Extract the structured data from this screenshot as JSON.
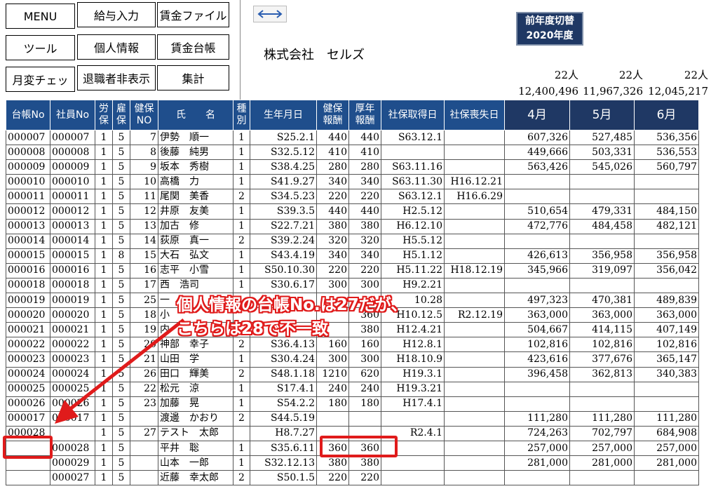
{
  "buttons": {
    "menu": "MENU",
    "kyuyo": "給与入力",
    "chingin_file": "賃金ファイル",
    "tool": "ツール",
    "kojin": "個人情報",
    "chingin_daicho": "賃金台帳",
    "getsuhen": "月変チェッ",
    "taishoku": "退職者非表示",
    "shukei": "集計"
  },
  "arrow_button_icon": "left-right-arrow-icon",
  "company": "株式会社　セルズ",
  "fiscal_button": {
    "line1": "前年度切替",
    "line2": "2020年度"
  },
  "summary": {
    "headcount": [
      "22人",
      "22人",
      "22人"
    ],
    "totals": [
      "12,400,496",
      "11,967,326",
      "12,045,217"
    ]
  },
  "headers": {
    "daicho_no": "台帳No",
    "shain_no": "社員No",
    "rouho": [
      "労",
      "保"
    ],
    "koho": [
      "雇",
      "保"
    ],
    "kenpo_no": [
      "健保",
      "NO"
    ],
    "name": "氏　　名",
    "shubetsu": [
      "種",
      "別"
    ],
    "birth": "生年月日",
    "kenpo_hoshu": [
      "健保",
      "報酬"
    ],
    "kounen_hoshu": [
      "厚年",
      "報酬"
    ],
    "shuto": "社保取得日",
    "soshitsu": "社保喪失日",
    "months": [
      "4月",
      "5月",
      "6月"
    ]
  },
  "rows": [
    [
      "000007",
      "000007",
      "1",
      "5",
      "7",
      "伊勢　順一",
      "1",
      "S25.2.1",
      "440",
      "440",
      "S63.12.1",
      "",
      "607,326",
      "527,485",
      "536,356"
    ],
    [
      "000008",
      "000008",
      "1",
      "5",
      "8",
      "後藤　純男",
      "1",
      "S32.5.12",
      "410",
      "410",
      "",
      "",
      "449,666",
      "503,331",
      "536,553"
    ],
    [
      "000009",
      "000009",
      "1",
      "5",
      "9",
      "坂本　秀樹",
      "1",
      "S38.4.25",
      "280",
      "280",
      "S63.11.16",
      "",
      "563,426",
      "545,026",
      "560,797"
    ],
    [
      "000010",
      "000010",
      "1",
      "5",
      "10",
      "高橋　力",
      "1",
      "S41.9.27",
      "340",
      "340",
      "S63.11.30",
      "H16.12.21",
      "",
      "",
      ""
    ],
    [
      "000011",
      "000011",
      "1",
      "5",
      "11",
      "尾関　美香",
      "2",
      "S34.5.23",
      "220",
      "220",
      "S63.12.1",
      "H16.6.29",
      "",
      "",
      ""
    ],
    [
      "000012",
      "000012",
      "1",
      "5",
      "12",
      "井原　友美",
      "1",
      "S39.3.5",
      "440",
      "440",
      "H2.5.12",
      "",
      "510,654",
      "479,331",
      "484,150"
    ],
    [
      "000013",
      "000013",
      "1",
      "5",
      "13",
      "加古　修",
      "1",
      "S22.7.21",
      "380",
      "380",
      "H6.12.10",
      "",
      "472,776",
      "484,458",
      "482,121"
    ],
    [
      "000014",
      "000014",
      "1",
      "5",
      "14",
      "荻原　真一",
      "2",
      "S39.2.24",
      "320",
      "320",
      "H5.5.12",
      "",
      "",
      "",
      ""
    ],
    [
      "000015",
      "000015",
      "1",
      "8",
      "15",
      "大石　弘文",
      "1",
      "S43.4.19",
      "340",
      "340",
      "H5.1.12",
      "",
      "426,613",
      "356,958",
      "356,958"
    ],
    [
      "000016",
      "000016",
      "1",
      "5",
      "16",
      "志平　小雪",
      "1",
      "S50.10.30",
      "220",
      "220",
      "H5.11.22",
      "H18.12.19",
      "345,966",
      "319,097",
      "356,042"
    ],
    [
      "000018",
      "000018",
      "1",
      "5",
      "17",
      "西　浩司",
      "1",
      "S30.6.17",
      "300",
      "300",
      "H9.2.21",
      "",
      "",
      "",
      ""
    ],
    [
      "000019",
      "000019",
      "1",
      "5",
      "25",
      "一　",
      "",
      "",
      "",
      "",
      "10.28",
      "",
      "497,323",
      "470,381",
      "489,839"
    ],
    [
      "000020",
      "000020",
      "1",
      "5",
      "18",
      "小",
      "",
      "",
      "",
      "360",
      "H10.12.5",
      "R2.12.19",
      "363,000",
      "363,000",
      "363,000"
    ],
    [
      "000021",
      "000021",
      "1",
      "5",
      "19",
      "内",
      "",
      "",
      "",
      "380",
      "H12.4.21",
      "",
      "504,667",
      "414,115",
      "407,149"
    ],
    [
      "000022",
      "000022",
      "1",
      "5",
      "20",
      "神部　幸子",
      "2",
      "S36.4.13",
      "160",
      "160",
      "H12.8.1",
      "",
      "102,816",
      "102,816",
      "102,816"
    ],
    [
      "000023",
      "000023",
      "1",
      "5",
      "21",
      "山田　学",
      "1",
      "S30.4.24",
      "300",
      "300",
      "H18.10.9",
      "",
      "423,616",
      "377,676",
      "365,147"
    ],
    [
      "000024",
      "000024",
      "1",
      "5",
      "26",
      "田口　輝美",
      "2",
      "S48.1.18",
      "1210",
      "620",
      "H19.3.1",
      "",
      "396,458",
      "362,813",
      "340,383"
    ],
    [
      "000025",
      "000025",
      "1",
      "5",
      "22",
      "松元　涼",
      "1",
      "S17.4.1",
      "240",
      "240",
      "H19.3.21",
      "",
      "",
      "",
      ""
    ],
    [
      "000026",
      "000026",
      "1",
      "5",
      "23",
      "加藤　晃",
      "1",
      "S54.2.2",
      "180",
      "180",
      "H17.4.1",
      "",
      "",
      "",
      ""
    ],
    [
      "000017",
      "000017",
      "1",
      "5",
      "",
      "渡邊　かおり",
      "2",
      "S44.5.19",
      "",
      "",
      "",
      "",
      "111,280",
      "111,280",
      "111,280"
    ],
    [
      "000028",
      "",
      "1",
      "5",
      "27",
      "テスト　太郎",
      "",
      "H8.7.27",
      "",
      "",
      "R2.4.1",
      "",
      "724,263",
      "702,797",
      "684,908"
    ],
    [
      "",
      "000028",
      "1",
      "5",
      "",
      "平井　聡",
      "1",
      "S35.6.11",
      "360",
      "360",
      "",
      "",
      "257,000",
      "257,000",
      "257,000"
    ],
    [
      "",
      "000029",
      "1",
      "5",
      "",
      "山本　一郎",
      "1",
      "S32.12.13",
      "380",
      "380",
      "",
      "",
      "281,000",
      "281,000",
      "281,000"
    ],
    [
      "",
      "000027",
      "1",
      "5",
      "",
      "近藤　幸太郎",
      "2",
      "S50.1.5",
      "220",
      "220",
      "",
      "",
      "",
      "",
      ""
    ]
  ],
  "annotation": {
    "line1": "個人情報の台帳No.は27だが、",
    "line2": "こちらは28で不一致"
  },
  "colors": {
    "header_blue": "#1f4e8c",
    "month_navy": "#1f3864",
    "annotation_red": "#e01b1b"
  }
}
